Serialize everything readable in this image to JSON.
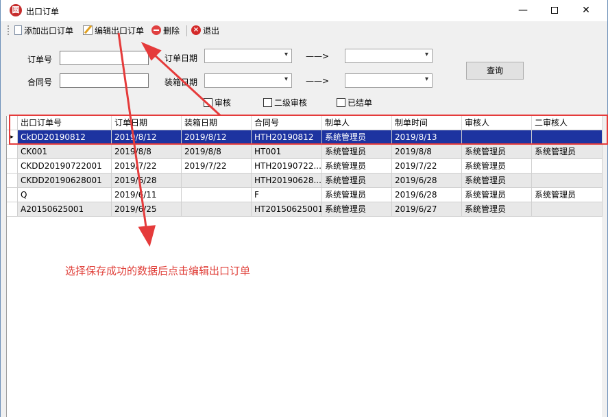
{
  "window": {
    "title": "出口订单",
    "app_icon": "app-logo-icon"
  },
  "toolbar": {
    "items": [
      {
        "label": "添加出口订单",
        "icon": "document-icon"
      },
      {
        "label": "编辑出口订单",
        "icon": "edit-icon"
      },
      {
        "label": "删除",
        "icon": "delete-icon"
      },
      {
        "label": "退出",
        "icon": "exit-icon"
      }
    ]
  },
  "search": {
    "order_no_label": "订单号",
    "order_no_value": "",
    "contract_no_label": "合同号",
    "contract_no_value": "",
    "order_date_label": "订单日期",
    "pack_date_label": "装箱日期",
    "range_arrow": "——>",
    "query_label": "查询",
    "checkboxes": [
      {
        "label": "审核",
        "checked": false
      },
      {
        "label": "二级审核",
        "checked": false
      },
      {
        "label": "已结单",
        "checked": false
      }
    ]
  },
  "grid": {
    "columns": [
      "出口订单号",
      "订单日期",
      "装箱日期",
      "合同号",
      "制单人",
      "制单时间",
      "审核人",
      "二审核人"
    ],
    "rows": [
      [
        "CkDD20190812",
        "2019/8/12",
        "2019/8/12",
        "HTH20190812",
        "系统管理员",
        "2019/8/13",
        "",
        ""
      ],
      [
        "CK001",
        "2019/8/8",
        "2019/8/8",
        "HT001",
        "系统管理员",
        "2019/8/8",
        "系统管理员",
        "系统管理员"
      ],
      [
        "CKDD20190722001",
        "2019/7/22",
        "2019/7/22",
        "HTH20190722...",
        "系统管理员",
        "2019/7/22",
        "系统管理员",
        ""
      ],
      [
        "CKDD20190628001",
        "2019/6/28",
        "",
        "HTH20190628...",
        "系统管理员",
        "2019/6/28",
        "系统管理员",
        ""
      ],
      [
        "Q",
        "2019/6/11",
        "",
        "F",
        "系统管理员",
        "2019/6/28",
        "系统管理员",
        "系统管理员"
      ],
      [
        "A20150625001",
        "2019/6/25",
        "",
        "HT20150625001",
        "系统管理员",
        "2019/6/27",
        "系统管理员",
        ""
      ]
    ],
    "selected_row": 0,
    "current_row_marker": "▸"
  },
  "annotation": {
    "text": "选择保存成功的数据后点击编辑出口订单",
    "color": "#e0403a"
  },
  "colors": {
    "selection": "#1d33a0",
    "highlight_box": "#e53b3b"
  }
}
